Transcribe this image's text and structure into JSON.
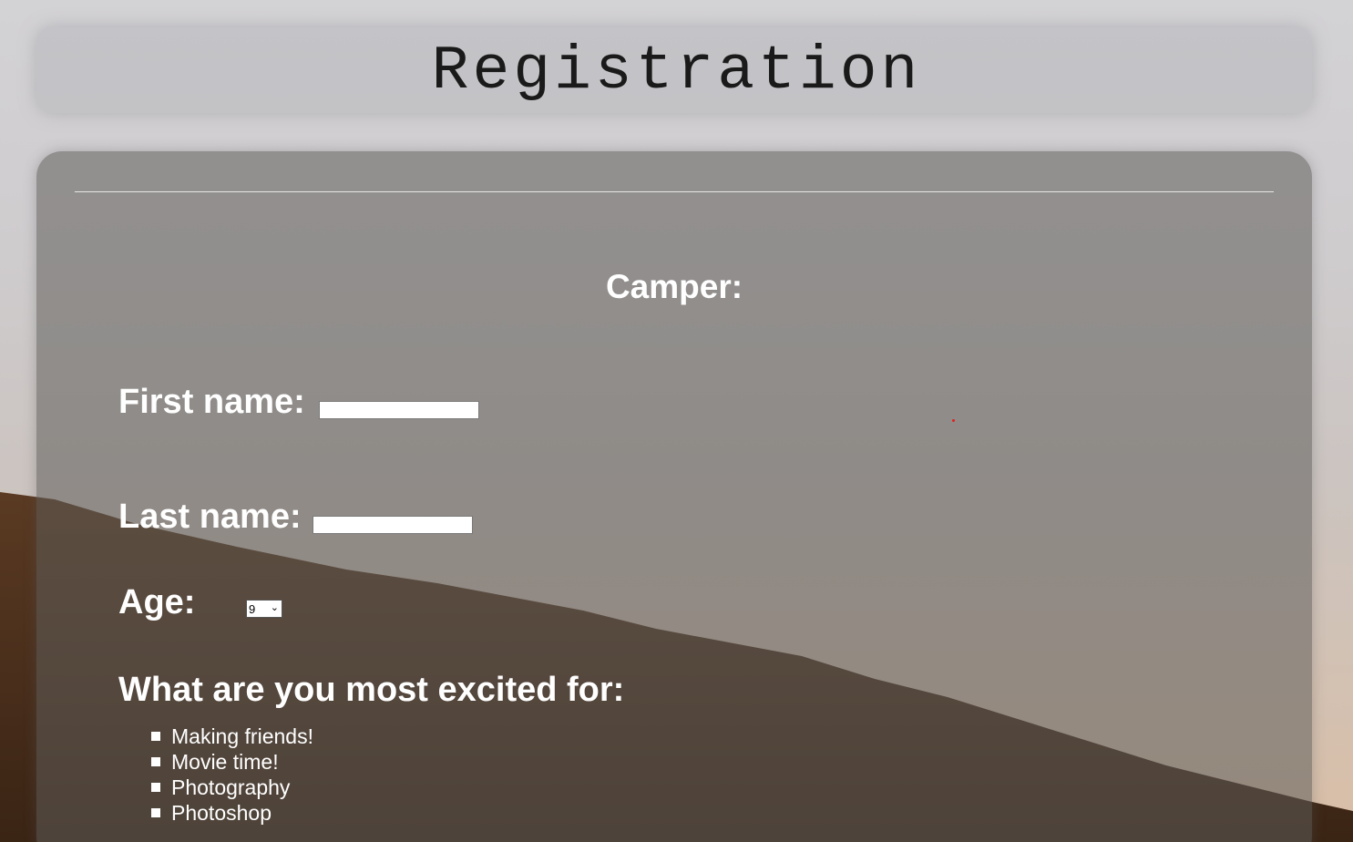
{
  "header": {
    "title": "Registration"
  },
  "form": {
    "section_title": "Camper:",
    "first_name": {
      "label": "First name:",
      "value": ""
    },
    "last_name": {
      "label": "Last name:",
      "value": ""
    },
    "age": {
      "label": "Age:",
      "selected": "9"
    },
    "excited": {
      "label": "What are you most excited for:",
      "options": [
        "Making friends!",
        "Movie time!",
        "Photography",
        "Photoshop"
      ]
    }
  },
  "colors": {
    "panel_text": "#ffffff",
    "title_text": "#1a1a1a"
  }
}
